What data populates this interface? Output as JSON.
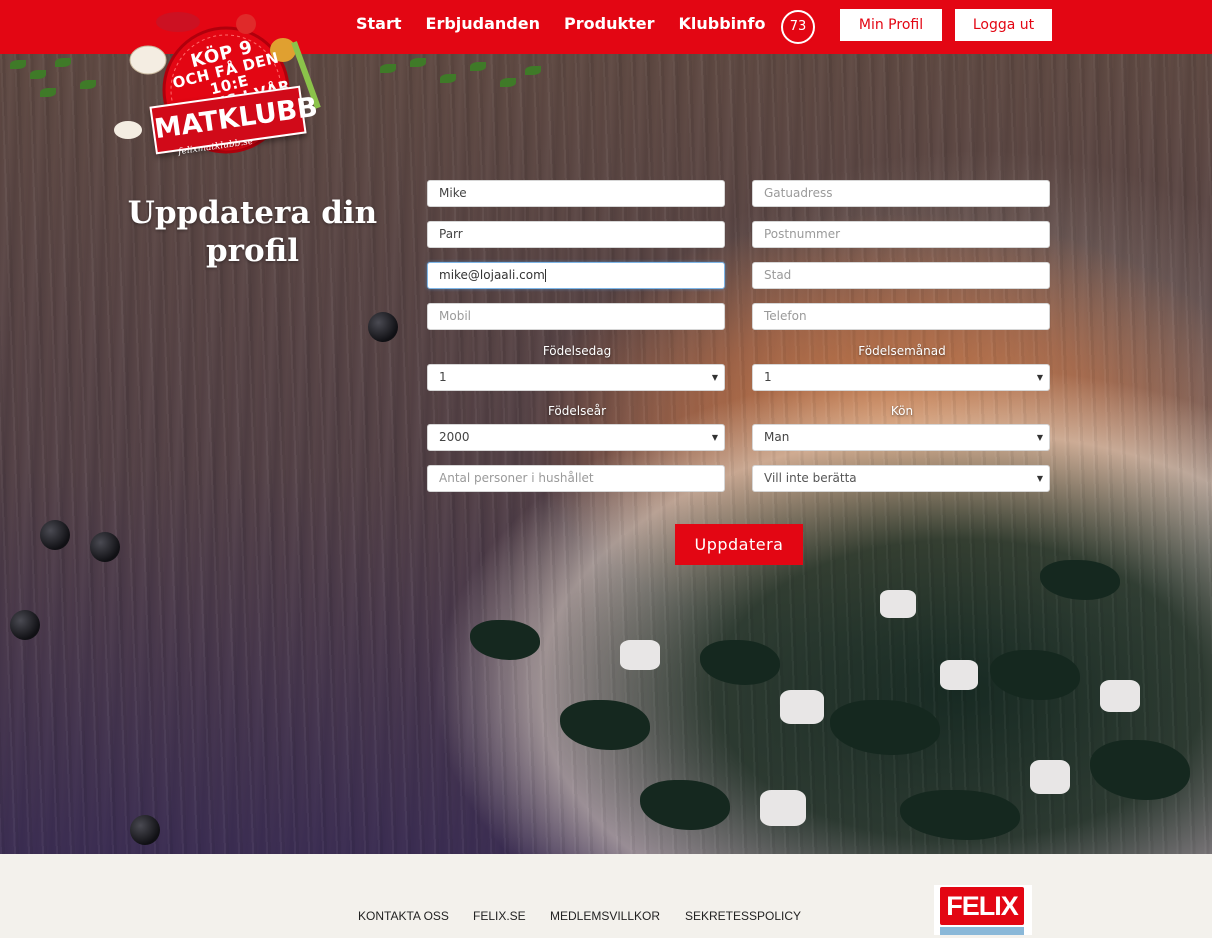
{
  "nav": {
    "items": [
      {
        "label": "Start"
      },
      {
        "label": "Erbjudanden"
      },
      {
        "label": "Produkter"
      },
      {
        "label": "Klubbinfo"
      }
    ],
    "points": "73",
    "profile_button": "Min Profil",
    "logout_button": "Logga ut"
  },
  "logo": {
    "line1": "KÖP 9",
    "line2": "OCH FÅ DEN 10:E",
    "line3": "GRATIS I VÅR NYA",
    "banner": "MATKLUBB",
    "site": "felixmatklubb.se"
  },
  "page": {
    "title": "Uppdatera din profil"
  },
  "form": {
    "first_name": {
      "value": "Mike"
    },
    "last_name": {
      "value": "Parr"
    },
    "email": {
      "value": "mike@lojaali.com"
    },
    "mobile": {
      "placeholder": "Mobil"
    },
    "street": {
      "placeholder": "Gatuadress"
    },
    "postal": {
      "placeholder": "Postnummer"
    },
    "city": {
      "placeholder": "Stad"
    },
    "phone": {
      "placeholder": "Telefon"
    },
    "birth_day": {
      "label": "Födelsedag",
      "value": "1"
    },
    "birth_month": {
      "label": "Födelsemånad",
      "value": "1"
    },
    "birth_year": {
      "label": "Födelseår",
      "value": "2000"
    },
    "gender": {
      "label": "Kön",
      "value": "Man"
    },
    "household": {
      "placeholder": "Antal personer i hushållet"
    },
    "household_select": {
      "value": "Vill inte berätta"
    },
    "submit": "Uppdatera"
  },
  "footer": {
    "links": [
      {
        "label": "KONTAKTA OSS"
      },
      {
        "label": "FELIX.SE"
      },
      {
        "label": "MEDLEMSVILLKOR"
      },
      {
        "label": "SEKRETESSPOLICY"
      }
    ],
    "brand": "FELIX"
  },
  "colors": {
    "brand_red": "#e30613",
    "footer_bg": "#f3f1ec"
  }
}
